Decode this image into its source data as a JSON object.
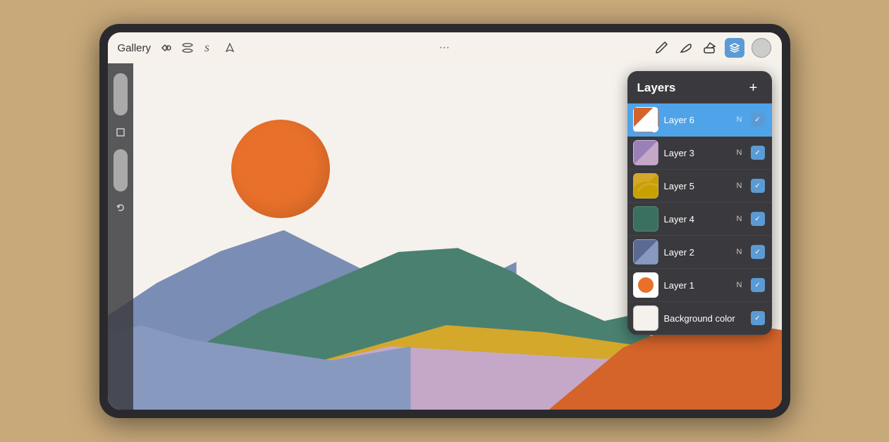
{
  "toolbar": {
    "gallery_label": "Gallery",
    "dots": "···",
    "icons_left": [
      "modify-icon",
      "transform-icon",
      "text-icon",
      "pen-icon"
    ],
    "icons_right": [
      "brush-icon",
      "smudge-icon",
      "eraser-icon"
    ],
    "layers_active": true,
    "profile_icon": "profile-icon"
  },
  "layers_panel": {
    "title": "Layers",
    "add_button": "+",
    "layers": [
      {
        "id": "layer6",
        "name": "Layer 6",
        "mode": "N",
        "active": true,
        "thumb_class": "thumb-6"
      },
      {
        "id": "layer3",
        "name": "Layer 3",
        "mode": "N",
        "active": false,
        "thumb_class": "thumb-3"
      },
      {
        "id": "layer5",
        "name": "Layer 5",
        "mode": "N",
        "active": false,
        "thumb_class": "thumb-5"
      },
      {
        "id": "layer4",
        "name": "Layer 4",
        "mode": "N",
        "active": false,
        "thumb_class": "thumb-4"
      },
      {
        "id": "layer2",
        "name": "Layer 2",
        "mode": "N",
        "active": false,
        "thumb_class": "thumb-2"
      },
      {
        "id": "layer1",
        "name": "Layer 1",
        "mode": "N",
        "active": false,
        "thumb_class": "thumb-1"
      },
      {
        "id": "background",
        "name": "Background color",
        "mode": "",
        "active": false,
        "thumb_class": "thumb-bg"
      }
    ]
  },
  "canvas": {
    "description": "Mountain landscape with sun"
  }
}
